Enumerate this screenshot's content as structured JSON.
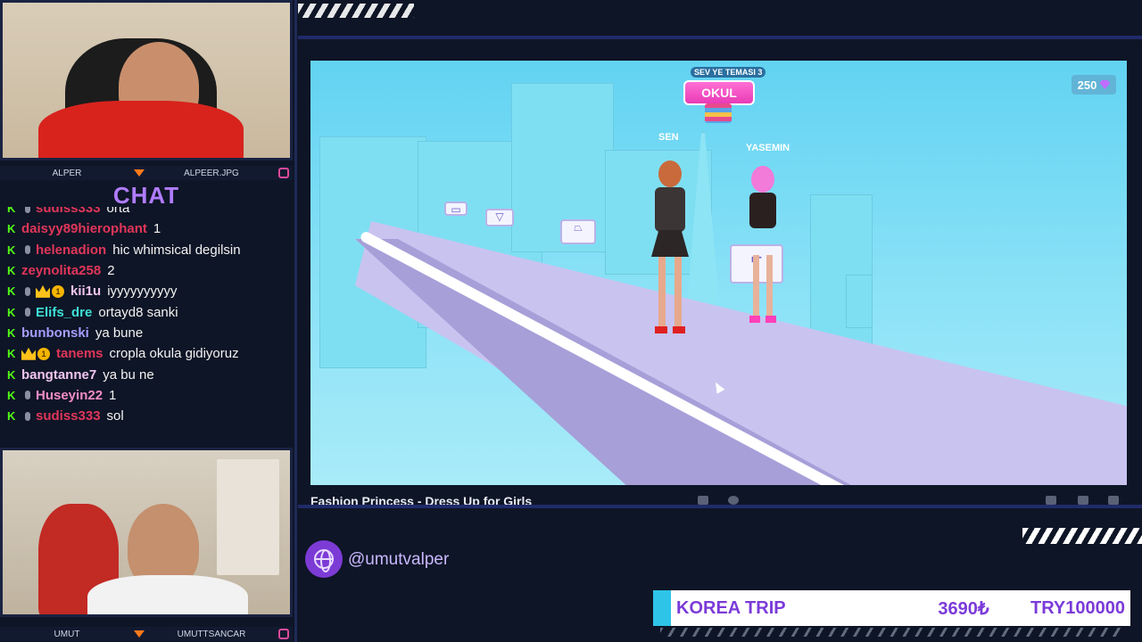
{
  "cams": {
    "top": {
      "left_label": "ALPER",
      "right_label": "ALPEER.JPG"
    },
    "bottom": {
      "left_label": "UMUT",
      "right_label": "UMUTTSANCAR"
    }
  },
  "chat": {
    "title": "CHAT",
    "messages": [
      {
        "user": "sudiss333",
        "color": "#e0365a",
        "text": "orta",
        "badges": [
          "mic-skull"
        ]
      },
      {
        "user": "daisyy89hierophant",
        "color": "#e0365a",
        "text": "1",
        "badges": []
      },
      {
        "user": "helenadion",
        "color": "#e0365a",
        "text": "hic whimsical degilsin",
        "badges": [
          "mic"
        ]
      },
      {
        "user": "zeynolita258",
        "color": "#e0365a",
        "text": "2",
        "badges": []
      },
      {
        "user": "kii1u",
        "color": "#f2c5f0",
        "text": "iyyyyyyyyyy",
        "badges": [
          "mic",
          "crown",
          "coin"
        ]
      },
      {
        "user": "Elifs_dre",
        "color": "#3ee0d6",
        "text": "ortayd8 sanki",
        "badges": [
          "mic"
        ]
      },
      {
        "user": "bunbonski",
        "color": "#a59cff",
        "text": "ya bune",
        "badges": []
      },
      {
        "user": "tanems",
        "color": "#e0365a",
        "text": "cropla okula gidiyoruz",
        "badges": [
          "crown",
          "coin"
        ]
      },
      {
        "user": "bangtanne7",
        "color": "#f2c5f0",
        "text": "ya bu ne",
        "badges": []
      },
      {
        "user": "Huseyin22",
        "color": "#f28cc8",
        "text": "1",
        "badges": [
          "mic"
        ]
      },
      {
        "user": "sudiss333",
        "color": "#e0365a",
        "text": "sol",
        "badges": [
          "mic-skull"
        ]
      }
    ],
    "coin_label": "1"
  },
  "game": {
    "title": "Fashion Princess - Dress Up for Girls",
    "gems": "250",
    "event_top": "SEV YE TEMASI 3",
    "event_label": "OKUL",
    "player_label": "SEN",
    "rival_label": "YASEMIN"
  },
  "social": {
    "handle": "@umutvalper"
  },
  "goal": {
    "name": "KOREA TRIP",
    "current": "3690₺",
    "target": "TRY100000",
    "progress": 0.0369
  },
  "colors": {
    "accent": "#7b3bd9",
    "chat_title": "#b07cff",
    "kick_green": "#53fc18",
    "goal_fill": "#2ec4e8"
  }
}
